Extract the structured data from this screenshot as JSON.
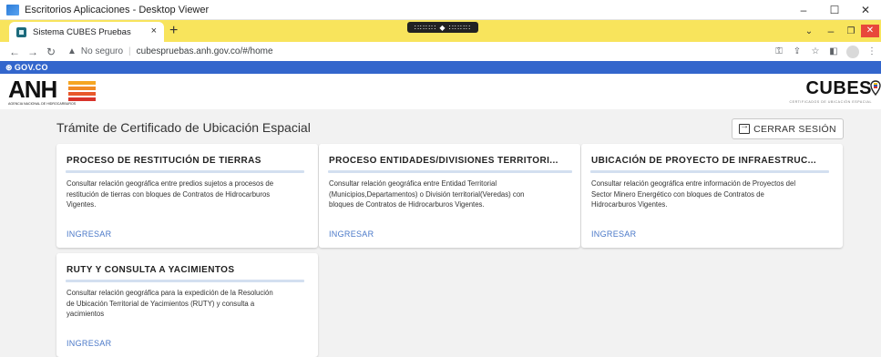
{
  "rdp": {
    "title": "Escritorios Aplicaciones - Desktop Viewer",
    "controls": [
      "–",
      "☐",
      "✕"
    ]
  },
  "browser": {
    "tab_title": "Sistema CUBES Pruebas",
    "tab_close": "×",
    "new_tab": "+",
    "remote_pill": "∷∷∷∷ ◆ ∷∷∷∷",
    "security_label": "No seguro",
    "url": "cubespruebas.anh.gov.co/#/home",
    "accent_color": "#f8e45c"
  },
  "gov": {
    "label": "GOV.CO",
    "color": "#3366cc"
  },
  "logos": {
    "anh_text": "ANH",
    "anh_sub": "AGENCIA NACIONAL DE HIDROCARBUROS",
    "cubes_text": "CUBES",
    "cubes_sub": "CERTIFICADOS DE UBICACIÓN ESPACIAL"
  },
  "page": {
    "title": "Trámite de Certificado de Ubicación Espacial",
    "logout_label": "CERRAR SESIÓN"
  },
  "cards": [
    {
      "title": "PROCESO DE RESTITUCIÓN DE TIERRAS",
      "description": [
        "Consultar relación geográfica entre predios sujetos a procesos de",
        "restitución de tierras con bloques de Contratos de Hidrocarburos",
        "Vigentes."
      ],
      "link": "INGRESAR"
    },
    {
      "title": "PROCESO ENTIDADES/DIVISIONES TERRITORI...",
      "description": [
        "Consultar relación geográfica entre Entidad Territorial",
        "(Municipios,Departamentos) o División territorial(Veredas) con",
        "bloques de Contratos de Hidrocarburos Vigentes."
      ],
      "link": "INGRESAR"
    },
    {
      "title": "UBICACIÓN DE PROYECTO DE INFRAESTRUC...",
      "description": [
        "Consultar relación geográfica entre información de Proyectos del",
        "Sector Minero Energético con bloques de Contratos de",
        "Hidrocarburos Vigentes."
      ],
      "link": "INGRESAR"
    },
    {
      "title": "RUTY Y CONSULTA A YACIMIENTOS",
      "description": [
        "Consultar relación geográfica para la expedición de la Resolución",
        "de Ubicación Territorial de Yacimientos (RUTY) y consulta a",
        "yacimientos"
      ],
      "link": "INGRESAR"
    }
  ]
}
